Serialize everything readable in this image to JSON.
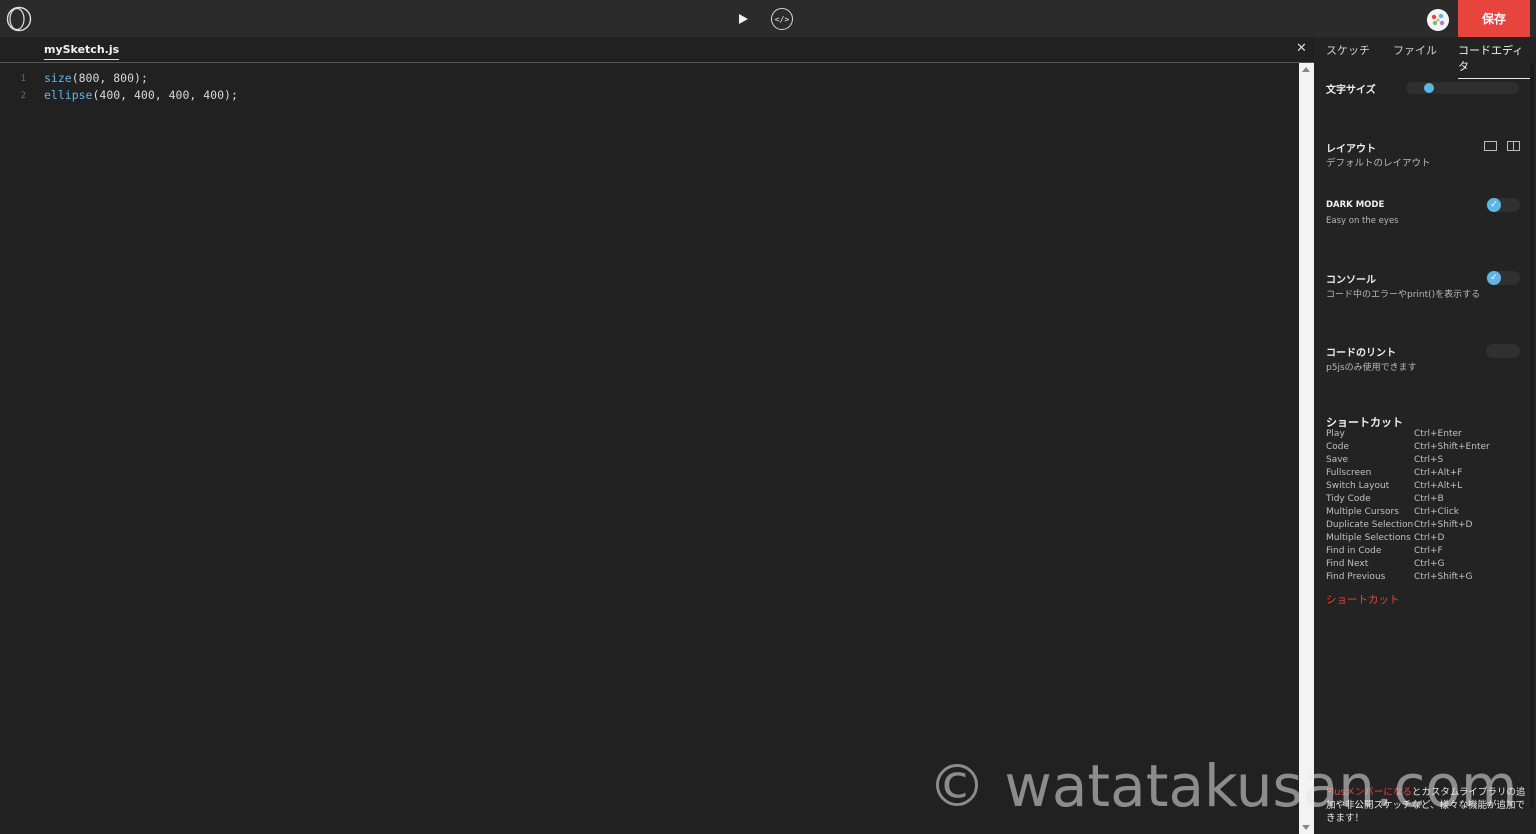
{
  "topbar": {
    "logo_icon": "openprocessing-logo-icon",
    "play_icon": "play-icon",
    "code_toggle_label": "</>",
    "avatar_icon": "user-avatar-icon",
    "save_label": "保存",
    "accent_color": "#e8443e"
  },
  "editor": {
    "file_tab": "mySketch.js",
    "line_numbers": [
      "1",
      "2"
    ],
    "lines": [
      {
        "fn": "size",
        "args": "(800, 800);"
      },
      {
        "fn": "ellipse",
        "args": "(400, 400, 400, 400);"
      }
    ]
  },
  "panel": {
    "tabs": [
      "スケッチ",
      "ファイル",
      "コードエディタ"
    ],
    "active_tab": "コードエディタ",
    "font_size": {
      "label": "文字サイズ"
    },
    "layout": {
      "label": "レイアウト",
      "sub": "デフォルトのレイアウト"
    },
    "dark_mode": {
      "label": "DARK MODE",
      "sub": "Easy on the eyes",
      "on": true
    },
    "console": {
      "label": "コンソール",
      "sub": "コード中のエラーやprint()を表示する",
      "on": true
    },
    "lint": {
      "label": "コードのリント",
      "sub": "p5jsのみ使用できます",
      "on": false
    },
    "shortcuts": {
      "title": "ショートカット",
      "items": [
        {
          "action": "Play",
          "keys": "Ctrl+Enter"
        },
        {
          "action": "Code",
          "keys": "Ctrl+Shift+Enter"
        },
        {
          "action": "Save",
          "keys": "Ctrl+S"
        },
        {
          "action": "Fullscreen",
          "keys": "Ctrl+Alt+F"
        },
        {
          "action": "Switch Layout",
          "keys": "Ctrl+Alt+L"
        },
        {
          "action": "Tidy Code",
          "keys": "Ctrl+B"
        },
        {
          "action": "Multiple Cursors",
          "keys": "Ctrl+Click"
        },
        {
          "action": "Duplicate Selection",
          "keys": "Ctrl+Shift+D"
        },
        {
          "action": "Multiple Selections",
          "keys": "Ctrl+D"
        },
        {
          "action": "Find in Code",
          "keys": "Ctrl+F"
        },
        {
          "action": "Find Next",
          "keys": "Ctrl+G"
        },
        {
          "action": "Find Previous",
          "keys": "Ctrl+Shift+G"
        }
      ],
      "link": "ショートカット"
    },
    "promo": {
      "link": "Plusメンバーになる",
      "text": "とカスタムライブラリの追加や非公開スケッチなど、様々な機能が追加できます！"
    }
  },
  "watermark": "© watatakusan.com"
}
